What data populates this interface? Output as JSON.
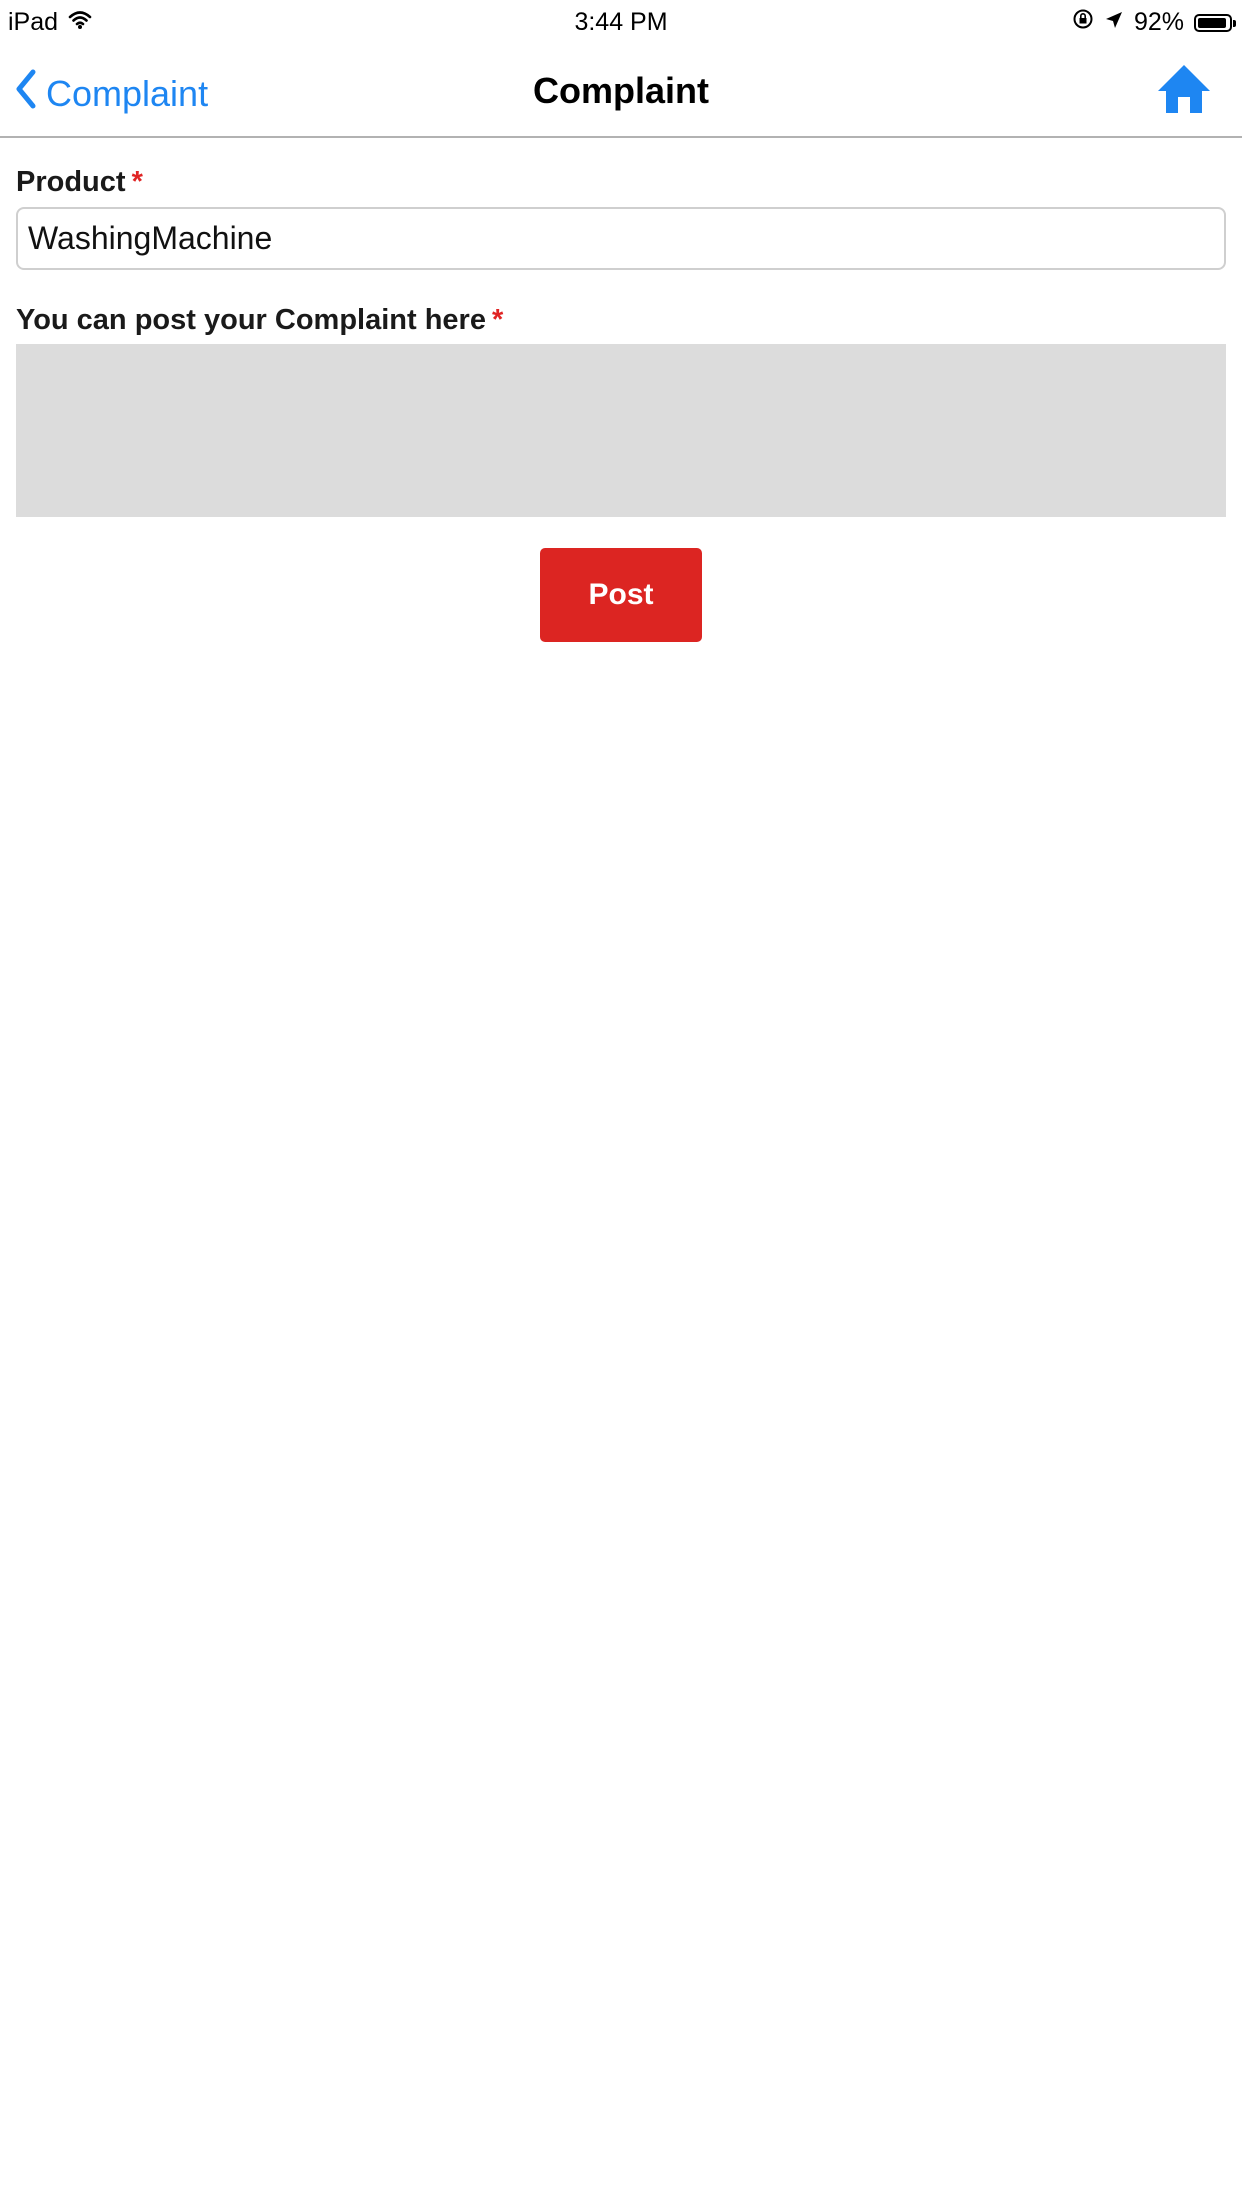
{
  "status_bar": {
    "device": "iPad",
    "time": "3:44 PM",
    "battery_text": "92%",
    "battery_level": 0.92
  },
  "nav": {
    "back_label": "Complaint",
    "title": "Complaint",
    "accent_color": "#1e86f2"
  },
  "form": {
    "product_label": "Product",
    "product_value": "WashingMachine",
    "complaint_label": "You can post your Complaint here",
    "complaint_value": "",
    "required_marker": "*",
    "post_label": "Post",
    "post_color": "#dc2522"
  },
  "icons": {
    "wifi": "wifi-icon",
    "orientation_lock": "orientation-lock-icon",
    "location": "location-arrow-icon",
    "battery": "battery-icon",
    "back": "chevron-left-icon",
    "home": "home-icon"
  }
}
